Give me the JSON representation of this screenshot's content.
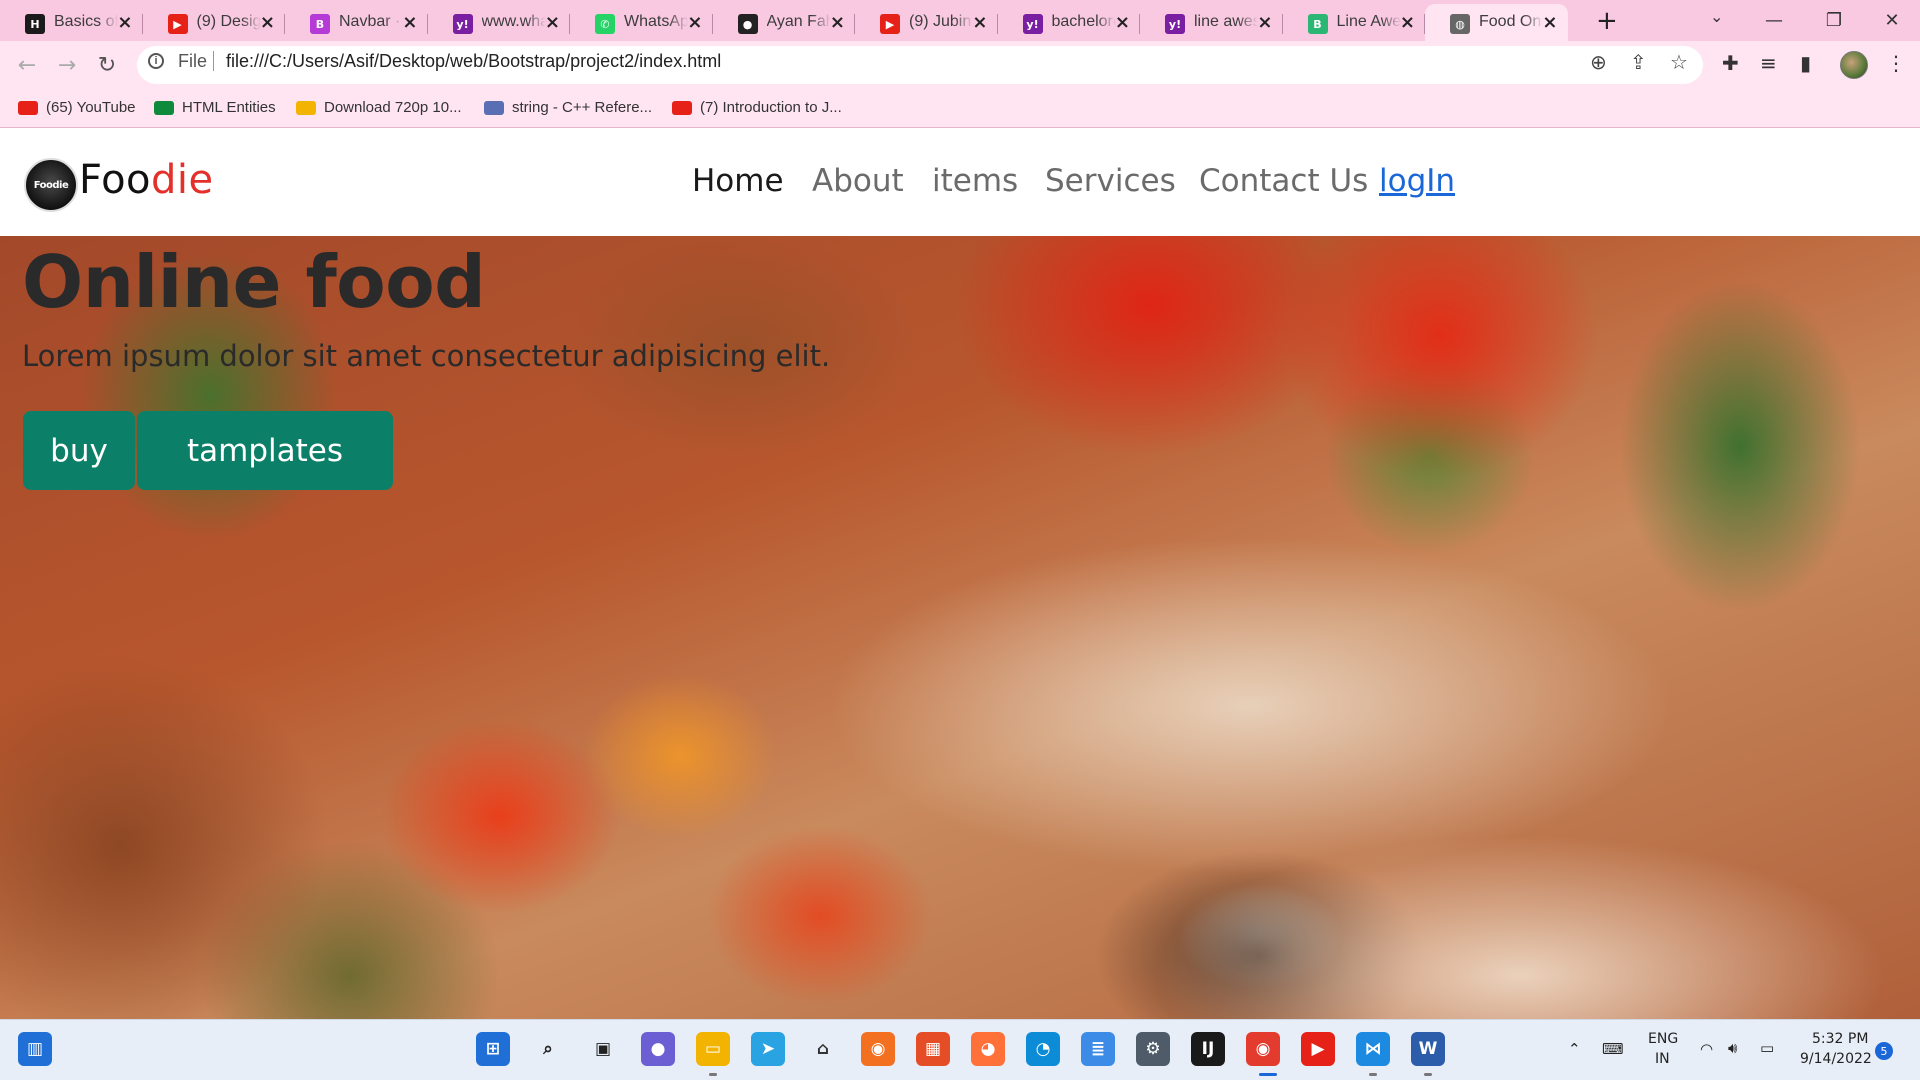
{
  "browser": {
    "tabs": [
      {
        "label": "Basics of",
        "icon": "hackerrank-icon",
        "icon_text": "H",
        "color": "#1b1b1b"
      },
      {
        "label": "(9) Desigr",
        "icon": "youtube-icon",
        "icon_text": "▶",
        "color": "#e62117"
      },
      {
        "label": "Navbar · F",
        "icon": "bootstrap-icon",
        "icon_text": "B",
        "color": "#b63ad6"
      },
      {
        "label": "www.wha",
        "icon": "yahoo-icon",
        "icon_text": "y!",
        "color": "#7b1fa2"
      },
      {
        "label": "WhatsApp",
        "icon": "whatsapp-icon",
        "icon_text": "✆",
        "color": "#25d366"
      },
      {
        "label": "Ayan Fah",
        "icon": "github-icon",
        "icon_text": "●",
        "color": "#222222"
      },
      {
        "label": "(9) Jubin",
        "icon": "youtube-icon",
        "icon_text": "▶",
        "color": "#e62117"
      },
      {
        "label": "bachelore",
        "icon": "yahoo-icon",
        "icon_text": "y!",
        "color": "#7b1fa2"
      },
      {
        "label": "line awes",
        "icon": "yahoo-icon",
        "icon_text": "y!",
        "color": "#7b1fa2"
      },
      {
        "label": "Line Awe",
        "icon": "codepen-icon",
        "icon_text": "B",
        "color": "#2bb673"
      },
      {
        "label": "Food Onl",
        "icon": "globe-icon",
        "icon_text": "◍",
        "color": "#666666",
        "active": true
      }
    ],
    "new_tab": "+",
    "window_controls": {
      "minimize": "—",
      "maximize": "❐",
      "close": "✕"
    },
    "address": {
      "scheme_label": "File",
      "url": "file:///C:/Users/Asif/Desktop/web/Bootstrap/project2/index.html"
    },
    "bookmarks": [
      {
        "label": "(65) YouTube",
        "icon": "youtube-icon",
        "color": "#e62117"
      },
      {
        "label": "HTML Entities",
        "icon": "w3schools-icon",
        "color": "#0e8a3c"
      },
      {
        "label": "Download 720p 10...",
        "icon": "emoji-icon",
        "color": "#f2b400"
      },
      {
        "label": "string - C++ Refere...",
        "icon": "cplusplus-icon",
        "color": "#5a6fb3"
      },
      {
        "label": "(7) Introduction to J...",
        "icon": "youtube-icon",
        "color": "#e62117"
      }
    ]
  },
  "site": {
    "brand_part1": "Foo",
    "brand_part2": "die",
    "logo_text": "Foodie",
    "nav": [
      {
        "label": "Home",
        "active": true
      },
      {
        "label": "About"
      },
      {
        "label": "items"
      },
      {
        "label": "Services"
      },
      {
        "label": "Contact Us"
      },
      {
        "label": "logIn",
        "link": true
      }
    ],
    "hero": {
      "title": "Online food",
      "subtitle": "Lorem ipsum dolor sit amet consectetur adipisicing elit.",
      "button_primary": "buy",
      "button_secondary": "tamplates"
    },
    "colors": {
      "brand_red": "#e4302b",
      "button_green": "#0c7f68",
      "login_blue": "#1b67d8"
    }
  },
  "taskbar": {
    "apps": [
      {
        "name": "start-icon",
        "color": "#1f6fd6",
        "glyph": "⊞"
      },
      {
        "name": "search-icon",
        "color": "#222222",
        "glyph": "⌕"
      },
      {
        "name": "task-view-icon",
        "color": "#222222",
        "glyph": "▣"
      },
      {
        "name": "teams-chat-icon",
        "color": "#6b5fd3",
        "glyph": "●"
      },
      {
        "name": "file-explorer-icon",
        "color": "#f2b400",
        "glyph": "▭"
      },
      {
        "name": "telegram-icon",
        "color": "#2aa3e3",
        "glyph": "➤"
      },
      {
        "name": "store-icon",
        "color": "#333333",
        "glyph": "⌂"
      },
      {
        "name": "screen-capture-icon",
        "color": "#f37021",
        "glyph": "◉"
      },
      {
        "name": "office-icon",
        "color": "#e44d26",
        "glyph": "▦"
      },
      {
        "name": "firefox-icon",
        "color": "#ff7139",
        "glyph": "◕"
      },
      {
        "name": "edge-icon",
        "color": "#0c8bd6",
        "glyph": "◔"
      },
      {
        "name": "notepad-icon",
        "color": "#3c8ce7",
        "glyph": "≣"
      },
      {
        "name": "settings-icon",
        "color": "#4f5b69",
        "glyph": "⚙"
      },
      {
        "name": "intellij-icon",
        "color": "#1a1a1a",
        "glyph": "IJ"
      },
      {
        "name": "chrome-icon",
        "color": "#e33b2e",
        "glyph": "◉"
      },
      {
        "name": "youtube-icon",
        "color": "#e62117",
        "glyph": "▶"
      },
      {
        "name": "vscode-icon",
        "color": "#1c8ae0",
        "glyph": "⋈"
      },
      {
        "name": "word-icon",
        "color": "#2b5dab",
        "glyph": "W"
      }
    ],
    "language_line1": "ENG",
    "language_line2": "IN",
    "time": "5:32 PM",
    "date": "9/14/2022",
    "notification_count": "5"
  }
}
